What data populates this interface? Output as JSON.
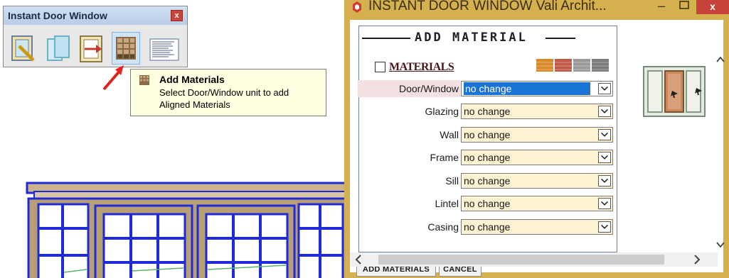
{
  "toolbar": {
    "title": "Instant Door Window",
    "close_glyph": "x",
    "buttons": [
      {
        "icon": "pencil-door-icon"
      },
      {
        "icon": "door-frames-icon"
      },
      {
        "icon": "door-arrow-icon"
      },
      {
        "icon": "materials-grid-icon",
        "selected": true
      },
      {
        "icon": "list-menu-icon"
      }
    ]
  },
  "tooltip": {
    "title": "Add Materials",
    "lines": [
      "Select Door/Window unit to add",
      "Aligned Materials"
    ]
  },
  "dialog": {
    "title": "INSTANT DOOR WINDOW   Vali Archit...",
    "min_glyph": "–",
    "close_glyph": "x",
    "section_header": "ADD MATERIAL",
    "materials_label": "MATERIALS",
    "materials_checked": false,
    "swatch_colors": [
      "#d98a2b",
      "#c25a4a",
      "#9a9a9a",
      "#7c7c7c"
    ],
    "fields": [
      {
        "label": "Door/Window",
        "value": "no change",
        "active": true,
        "highlight": true
      },
      {
        "label": "Glazing",
        "value": "no change"
      },
      {
        "label": "Wall",
        "value": "no change"
      },
      {
        "label": "Frame",
        "value": "no change"
      },
      {
        "label": "Sill",
        "value": "no change"
      },
      {
        "label": "Lintel",
        "value": "no change"
      },
      {
        "label": "Casing",
        "value": "no change"
      }
    ],
    "add_button": "ADD MATERIALS",
    "cancel_button": "CANCEL",
    "preview_icon": "window-preview-icon"
  },
  "colors": {
    "dialog_frame": "#d4b14e",
    "select_bg": "#fdf2d2",
    "selection_blue": "#1a73d6",
    "model_outline": "#1f2bd6",
    "model_frame": "#b79e74"
  }
}
